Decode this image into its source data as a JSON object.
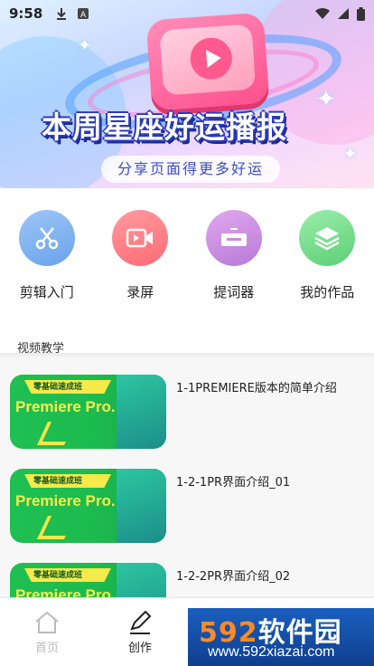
{
  "status_bar": {
    "time": "9:58"
  },
  "banner": {
    "title": "本周星座好运播报",
    "subtitle": "分享页面得更多好运"
  },
  "actions": [
    {
      "label": "剪辑入门",
      "icon": "scissors-icon",
      "color": "#7fb3f0"
    },
    {
      "label": "录屏",
      "icon": "video-camera-icon",
      "color": "#ff7f86"
    },
    {
      "label": "提词器",
      "icon": "teleprompter-icon",
      "color": "#c98ce0"
    },
    {
      "label": "我的作品",
      "icon": "layers-icon",
      "color": "#79dd8c"
    }
  ],
  "section": {
    "title": "视频教学"
  },
  "videos": [
    {
      "title": "1-1PREMIERE版本的简单介绍",
      "thumb_badge": "零基础速成班",
      "thumb_text": "Premiere Pro."
    },
    {
      "title": "1-2-1PR界面介绍_01",
      "thumb_badge": "零基础速成班",
      "thumb_text": "Premiere Pro."
    },
    {
      "title": "1-2-2PR界面介绍_02",
      "thumb_badge": "零基础速成班",
      "thumb_text": "Premiere Pro."
    }
  ],
  "bottom_nav": {
    "home_label": "首页",
    "create_label": "创作",
    "active": "create"
  },
  "watermark": {
    "brand_prefix": "592",
    "brand_suffix": "软件园",
    "url": "www.592xiazai.com"
  }
}
